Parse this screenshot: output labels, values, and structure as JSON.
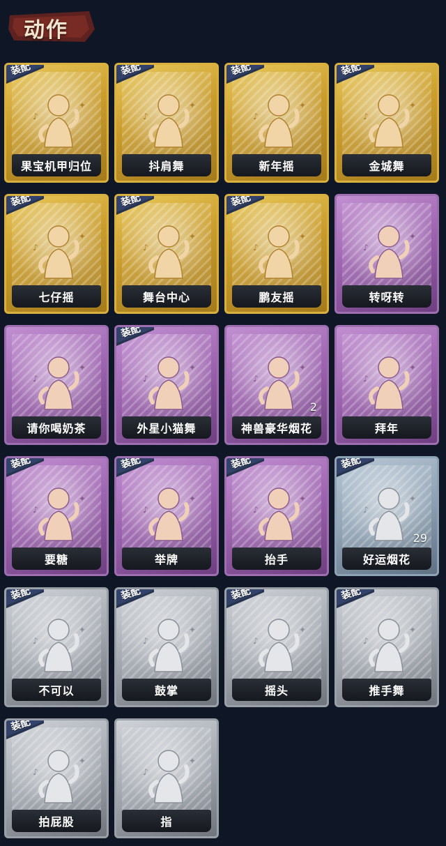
{
  "header": {
    "title": "动作"
  },
  "equip_badge": "装配",
  "colors": {
    "gold": "#c99c2c",
    "purple": "#9b62ad",
    "blue": "#8fa2b3",
    "gray": "#a3a8b0",
    "background": "#0f1625"
  },
  "actions": [
    {
      "label": "果宝机甲归位",
      "tier": "gold",
      "equipped": true,
      "icon": "dance-figure-icon"
    },
    {
      "label": "抖肩舞",
      "tier": "gold",
      "equipped": true,
      "icon": "dance-figure-icon"
    },
    {
      "label": "新年摇",
      "tier": "gold",
      "equipped": true,
      "icon": "dance-figure-icon"
    },
    {
      "label": "金城舞",
      "tier": "gold",
      "equipped": true,
      "icon": "dance-figure-icon"
    },
    {
      "label": "七仔摇",
      "tier": "gold",
      "equipped": true,
      "icon": "dance-figure-icon"
    },
    {
      "label": "舞台中心",
      "tier": "gold",
      "equipped": true,
      "icon": "dance-figure-icon"
    },
    {
      "label": "鹏友摇",
      "tier": "gold",
      "equipped": true,
      "icon": "dance-figure-icon"
    },
    {
      "label": "转呀转",
      "tier": "purple",
      "equipped": false,
      "icon": "girl-with-rabbit-icon"
    },
    {
      "label": "请你喝奶茶",
      "tier": "purple",
      "equipped": false,
      "icon": "figure-with-sign-icon"
    },
    {
      "label": "外星小猫舞",
      "tier": "purple",
      "equipped": true,
      "icon": "dance-figure-icon"
    },
    {
      "label": "神兽豪华烟花",
      "tier": "purple",
      "equipped": false,
      "icon": "fireworks-icon",
      "count": "2"
    },
    {
      "label": "拜年",
      "tier": "purple",
      "equipped": false,
      "icon": "bowing-figure-icon"
    },
    {
      "label": "要糖",
      "tier": "purple",
      "equipped": true,
      "icon": "pointing-figure-icon"
    },
    {
      "label": "举牌",
      "tier": "purple",
      "equipped": true,
      "icon": "holding-sign-icon"
    },
    {
      "label": "抬手",
      "tier": "purple",
      "equipped": true,
      "icon": "raising-hand-icon"
    },
    {
      "label": "好运烟花",
      "tier": "blue",
      "equipped": true,
      "icon": "firework-can-icon",
      "count": "29"
    },
    {
      "label": "不可以",
      "tier": "gray",
      "equipped": true,
      "icon": "finger-wag-icon"
    },
    {
      "label": "鼓掌",
      "tier": "gray",
      "equipped": true,
      "icon": "clapping-hands-icon"
    },
    {
      "label": "摇头",
      "tier": "gray",
      "equipped": true,
      "icon": "head-shake-icon"
    },
    {
      "label": "推手舞",
      "tier": "gray",
      "equipped": true,
      "icon": "push-hands-icon"
    },
    {
      "label": "拍屁股",
      "tier": "gray",
      "equipped": true,
      "icon": "butt-slap-icon"
    },
    {
      "label": "指",
      "tier": "gray",
      "equipped": false,
      "icon": "point-hand-icon"
    }
  ]
}
